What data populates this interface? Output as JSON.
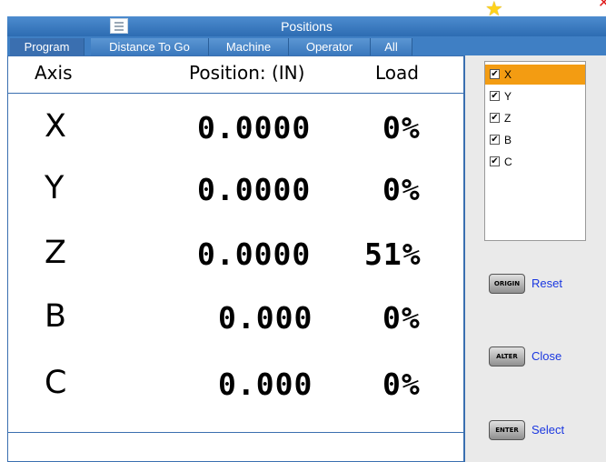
{
  "window": {
    "title": "Positions"
  },
  "tabs": [
    {
      "label": "Program"
    },
    {
      "label": "Distance To Go"
    },
    {
      "label": "Machine"
    },
    {
      "label": "Operator"
    },
    {
      "label": "All"
    }
  ],
  "table": {
    "headers": {
      "axis": "Axis",
      "position": "Position:  (IN)",
      "load": "Load"
    },
    "rows": [
      {
        "axis": "X",
        "position": "0.0000",
        "load": "0%"
      },
      {
        "axis": "Y",
        "position": "0.0000",
        "load": "0%"
      },
      {
        "axis": "Z",
        "position": "0.0000",
        "load": "51%"
      },
      {
        "axis": "B",
        "position": "0.000",
        "load": "0%"
      },
      {
        "axis": "C",
        "position": "0.000",
        "load": "0%"
      }
    ]
  },
  "axis_list": {
    "items": [
      {
        "label": "X",
        "checked": true,
        "selected": true
      },
      {
        "label": "Y",
        "checked": true,
        "selected": false
      },
      {
        "label": "Z",
        "checked": true,
        "selected": false
      },
      {
        "label": "B",
        "checked": true,
        "selected": false
      },
      {
        "label": "C",
        "checked": true,
        "selected": false
      }
    ]
  },
  "actions": [
    {
      "key": "ORIGIN",
      "label": "Reset"
    },
    {
      "key": "ALTER",
      "label": "Close"
    },
    {
      "key": "ENTER",
      "label": "Select"
    }
  ],
  "colors": {
    "accent": "#3a6fb0",
    "selection": "#f39c12",
    "action_text": "#1a37e0",
    "star": "#ffd21a"
  },
  "icons": {
    "menu": "menu-icon",
    "favorite": "star-icon",
    "close": "close-icon",
    "check": "checkmark-icon"
  }
}
